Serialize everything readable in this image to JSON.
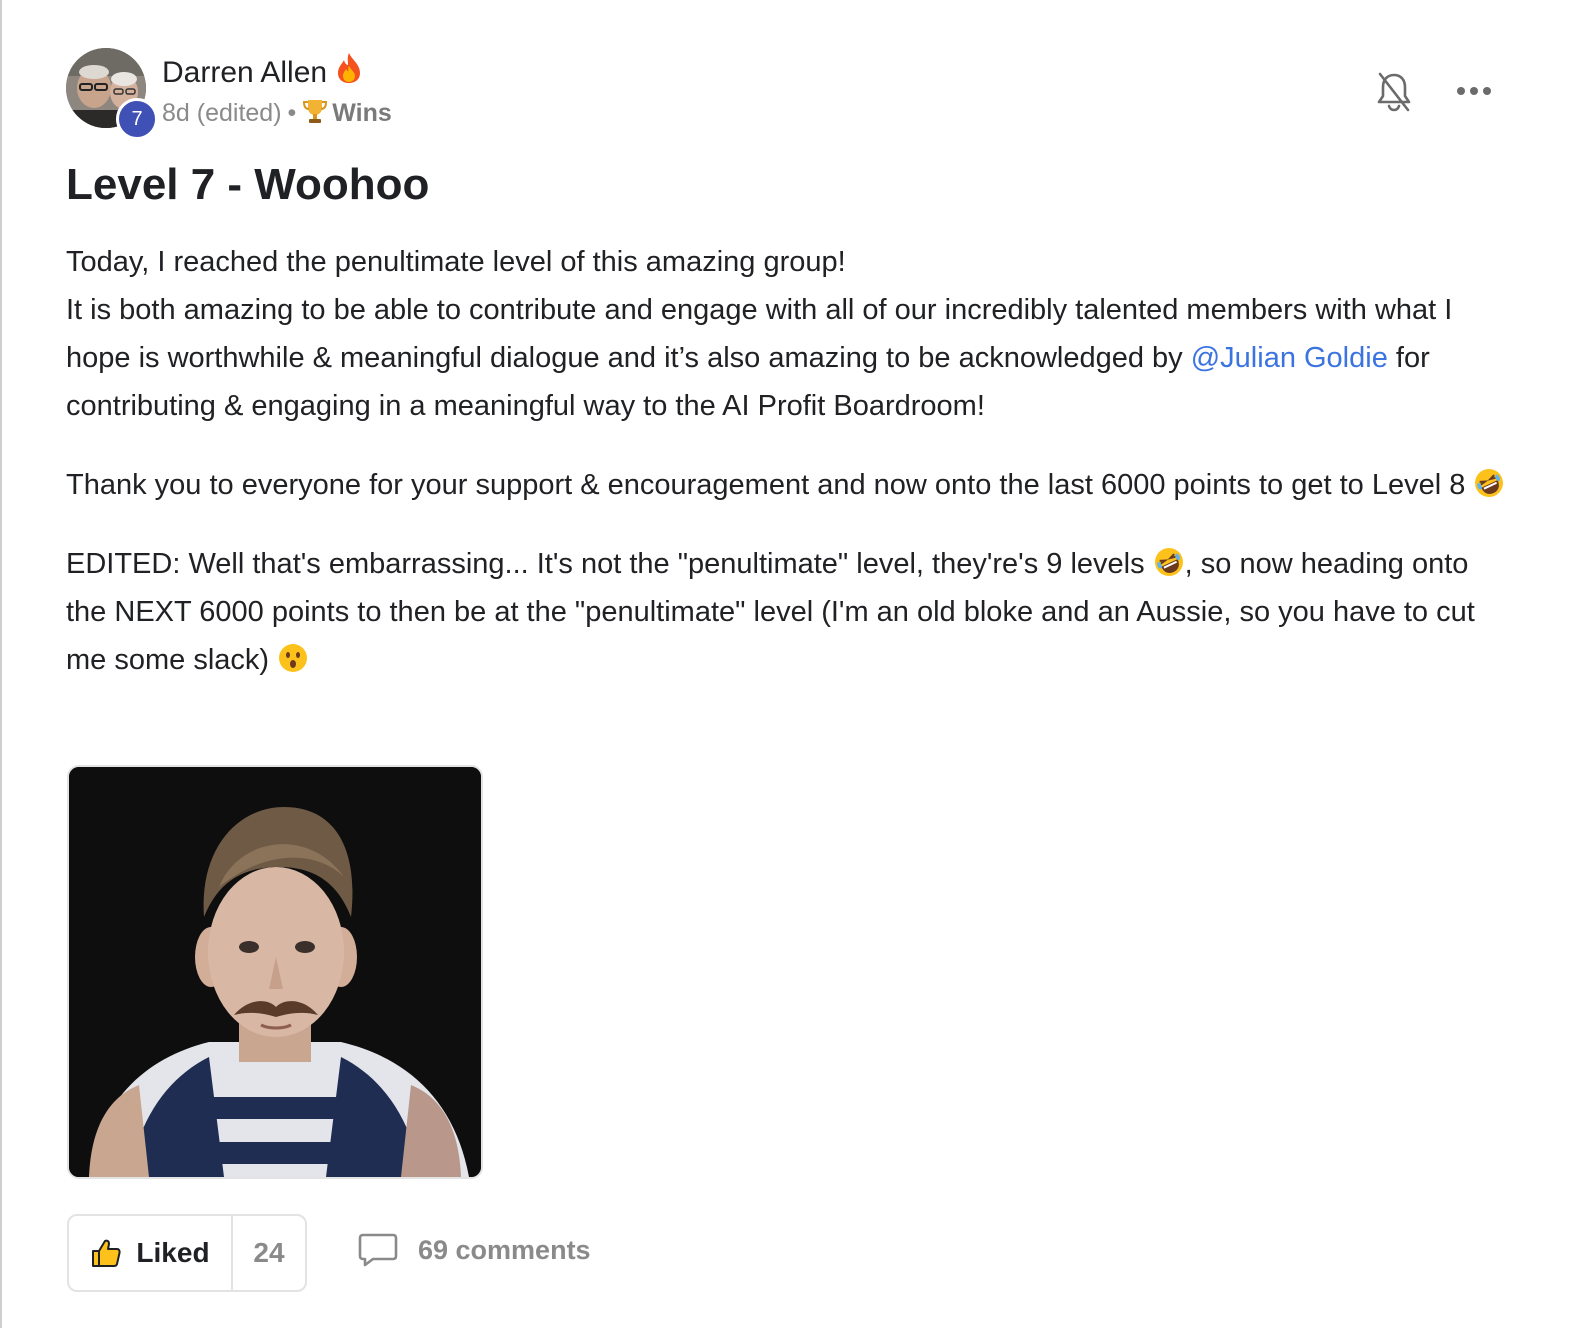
{
  "post": {
    "author": {
      "name": "Darren Allen",
      "level": "7",
      "avatar_icon": "user-avatar-photo",
      "flair_icon": "fire-icon"
    },
    "meta": {
      "time": "8d (edited)",
      "separator": "•",
      "category_icon": "trophy-icon",
      "category": "Wins"
    },
    "title": "Level 7 - Woohoo",
    "body": {
      "p1_line1": "Today, I reached the penultimate level of this amazing group!",
      "p1_line2": "It is both amazing to be able to contribute and engage with all of our incredibly talented members with what I hope is worthwhile & meaningful dialogue and it’s also amazing to be acknowledged by",
      "mention": "@Julian Goldie",
      "p1_line3": "for contributing & engaging in a meaningful way to the AI Profit Boardroom!",
      "p2": "Thank you to everyone for your support & encouragement and now onto the last 6000 points to get to Level 8",
      "p3_a": "EDITED: Well that's embarrassing... It's not the \"penultimate\" level, they're's 9 levels",
      "p3_b": ", so now heading onto the NEXT 6000 points to then be at the \"penultimate\" level (I'm an old bloke and an Aussie, so you have to cut me some slack)"
    },
    "image_alt": "animated-gif-boy-with-mustache",
    "actions": {
      "like_label": "Liked",
      "like_count": "24",
      "comments_label": "69 comments"
    },
    "colors": {
      "mention": "#3b73e0",
      "level_badge": "#3f51b5",
      "muted_text": "#8a8a8a"
    }
  }
}
